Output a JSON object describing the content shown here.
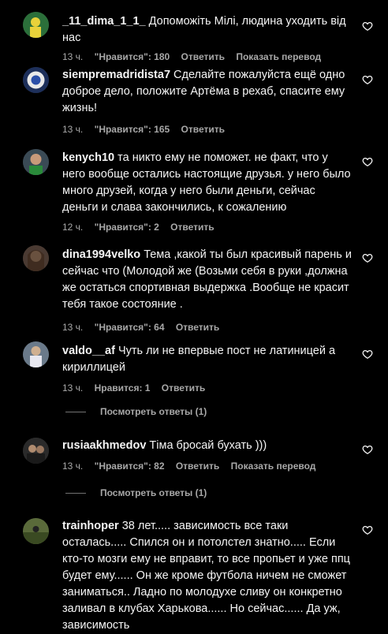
{
  "comments": [
    {
      "username": "_11_dima_1_1_",
      "text": "Допоможіть Мілі, людина уходить від нас",
      "time": "13 ч.",
      "likes": "\"Нравится\": 180",
      "reply": "Ответить",
      "translate": "Показать перевод"
    },
    {
      "username": "siempremadridista7",
      "text": "Сделайте пожалуйста ещё одно доброе дело, положите Артёма в рехаб, спасите ему жизнь!",
      "time": "13 ч.",
      "likes": "\"Нравится\": 165",
      "reply": "Ответить"
    },
    {
      "username": "kenych10",
      "text": "та никто ему не поможет. не факт, что у него вообще остались настоящие друзья. у него было много друзей, когда у него были деньги, сейчас деньги и слава закончились, к сожалению",
      "time": "12 ч.",
      "likes": "\"Нравится\": 2",
      "reply": "Ответить"
    },
    {
      "username": "dina1994velko",
      "text": "Тема ,какой ты был красивый парень и сейчас что (Молодой же (Возьми себя в руки ,должна же остаться спортивная выдержка .Вообще не красит тебя такое состояние .",
      "time": "13 ч.",
      "likes": "\"Нравится\": 64",
      "reply": "Ответить"
    },
    {
      "username": "valdo__af",
      "text": "Чуть ли не впервые пост не латиницей а кириллицей",
      "time": "13 ч.",
      "likes": "Нравится: 1",
      "reply": "Ответить",
      "view_replies": "Посмотреть ответы (1)"
    },
    {
      "username": "rusiaakhmedov",
      "text": "Тіма бросай бухать )))",
      "time": "13 ч.",
      "likes": "\"Нравится\": 82",
      "reply": "Ответить",
      "translate": "Показать перевод",
      "view_replies": "Посмотреть ответы (1)"
    },
    {
      "username": "trainhoper",
      "text": "38 лет..... зависимость все таки осталась..... Спился он и потолстел знатно..... Если кто-то мозги ему не вправит, то все пропьет и уже ппц будет ему...... Он же кроме футбола ничем не сможет заниматься.. Ладно по молодухе сливу он конкретно заливал в клубах Харькова...... Но сейчас...... Да уж, зависимость"
    }
  ],
  "colors": {
    "background": "#000000",
    "text": "#f5f5f5",
    "secondary": "#a8a8a8"
  }
}
